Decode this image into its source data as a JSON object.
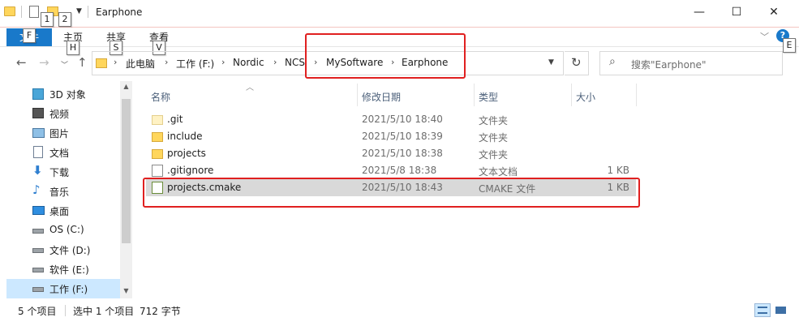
{
  "window": {
    "title": "Earphone",
    "minimize": "—",
    "maximize": "☐",
    "close": "✕"
  },
  "keytips": {
    "qa1": "1",
    "qa2": "2",
    "file": "F",
    "home": "H",
    "share": "S",
    "view": "V",
    "help": "E"
  },
  "ribbon": {
    "file_tab": "文件",
    "tabs": [
      "主页",
      "共享",
      "查看"
    ],
    "collapse": "﹀",
    "help": "?"
  },
  "nav": {
    "back": "←",
    "forward": "→",
    "recent": "﹀",
    "up": "↑"
  },
  "address": {
    "crumbs": [
      "此电脑",
      "工作 (F:)",
      "Nordic",
      "NCS",
      "MySoftware",
      "Earphone"
    ],
    "separator": "›"
  },
  "search": {
    "placeholder": "搜索\"Earphone\""
  },
  "sidebar": {
    "items": [
      {
        "label": "3D 对象",
        "icon": "cube-icon",
        "selected": false
      },
      {
        "label": "视频",
        "icon": "video-icon",
        "selected": false
      },
      {
        "label": "图片",
        "icon": "picture-icon",
        "selected": false
      },
      {
        "label": "文档",
        "icon": "document-icon",
        "selected": false
      },
      {
        "label": "下载",
        "icon": "download-icon",
        "selected": false
      },
      {
        "label": "音乐",
        "icon": "music-icon",
        "selected": false
      },
      {
        "label": "桌面",
        "icon": "desktop-icon",
        "selected": false
      },
      {
        "label": "OS (C:)",
        "icon": "drive-icon",
        "selected": false
      },
      {
        "label": "文件 (D:)",
        "icon": "drive-icon",
        "selected": false
      },
      {
        "label": "软件 (E:)",
        "icon": "drive-icon",
        "selected": false
      },
      {
        "label": "工作 (F:)",
        "icon": "drive-icon",
        "selected": true
      }
    ]
  },
  "columns": {
    "name": "名称",
    "date": "修改日期",
    "type": "类型",
    "size": "大小"
  },
  "files": [
    {
      "name": ".git",
      "date": "2021/5/10 18:40",
      "type": "文件夹",
      "size": "",
      "icon": "git-folder-icon",
      "selected": false
    },
    {
      "name": "include",
      "date": "2021/5/10 18:39",
      "type": "文件夹",
      "size": "",
      "icon": "folder-icon",
      "selected": false
    },
    {
      "name": "projects",
      "date": "2021/5/10 18:38",
      "type": "文件夹",
      "size": "",
      "icon": "folder-icon",
      "selected": false
    },
    {
      "name": ".gitignore",
      "date": "2021/5/8 18:38",
      "type": "文本文档",
      "size": "1 KB",
      "icon": "text-file-icon",
      "selected": false
    },
    {
      "name": "projects.cmake",
      "date": "2021/5/10 18:43",
      "type": "CMAKE 文件",
      "size": "1 KB",
      "icon": "cmake-file-icon",
      "selected": true
    }
  ],
  "status": {
    "count": "5 个项目",
    "selection": "选中 1 个项目",
    "size": "712 字节"
  },
  "colors": {
    "file_tab": "#1979ca",
    "highlight": "#e02020",
    "selected_row": "#d9d9d9",
    "selected_nav": "#cce8ff"
  }
}
